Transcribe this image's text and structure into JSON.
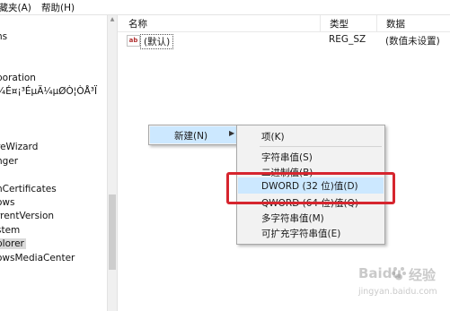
{
  "menubar": {
    "favorites": "收藏夹(A)",
    "help": "帮助(H)"
  },
  "tree": {
    "nodes": [
      "ns",
      "poration",
      "¾É¤¡³ÉµÄ¼µØÒ¦ÒÅ³Ï",
      "t",
      "reWizard",
      "nger",
      "nCertificates",
      "ows",
      "rrentVersion",
      "stem",
      "plorer",
      "owsMediaCenter"
    ],
    "selected": "plorer"
  },
  "list": {
    "columns": {
      "name": "名称",
      "type": "类型",
      "data": "数据"
    },
    "rows": [
      {
        "icon": "ab",
        "name": "(默认)",
        "type": "REG_SZ",
        "data": "(数值未设置)"
      }
    ]
  },
  "context_menu": {
    "parent": {
      "label": "新建(N)",
      "arrow": "▶"
    },
    "submenu": [
      {
        "label": "项(K)",
        "highlighted": false
      },
      {
        "label": "字符串值(S)",
        "highlighted": false
      },
      {
        "label": "二进制值(B)",
        "highlighted": false
      },
      {
        "label": "DWORD (32 位)值(D)",
        "highlighted": true
      },
      {
        "label": "QWORD (64 位)值(Q)",
        "highlighted": false
      },
      {
        "label": "多字符串值(M)",
        "highlighted": false
      },
      {
        "label": "可扩充字符串值(E)",
        "highlighted": false
      }
    ]
  },
  "annotation": {
    "color": "#d6252e"
  },
  "watermark": {
    "brand": "Baidu",
    "suffix": "经验",
    "url": "jingyan.baidu.com"
  },
  "colors": {
    "highlight": "#cce8ff",
    "menu_bg": "#f2f2f2"
  }
}
